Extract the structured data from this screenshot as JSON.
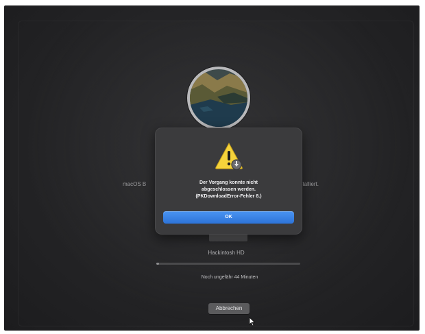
{
  "installer": {
    "message_left": "macOS B",
    "message_right": "nstalliert.",
    "disk_name": "Hackintosh HD",
    "progress_fraction": 0.02,
    "time_remaining": "Noch ungefähr 44 Minuten",
    "cancel_label": "Abbrechen"
  },
  "dialog": {
    "message_lines": [
      "Der Vorgang konnte nicht",
      "abgeschlossen werden.",
      "(PKDownloadError-Fehler 8.)"
    ],
    "ok_label": "OK",
    "icon": "warning-icon"
  },
  "colors": {
    "background": "#262628",
    "dialog": "#3b3b3d",
    "accent": "#2d73d8",
    "warning": "#f5d33b"
  }
}
